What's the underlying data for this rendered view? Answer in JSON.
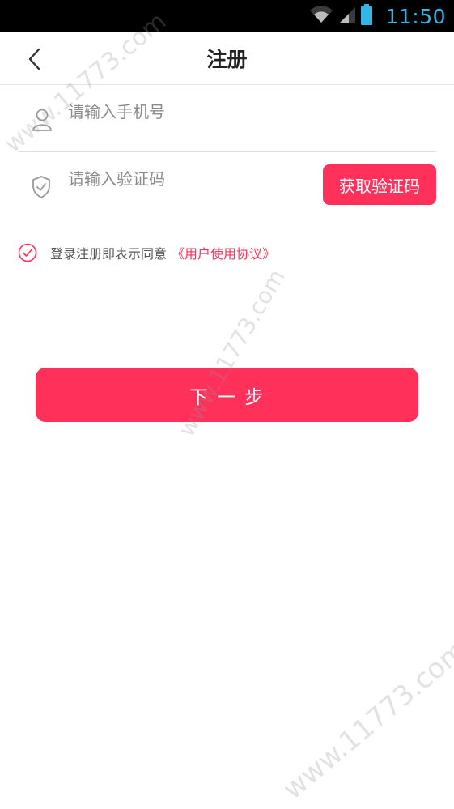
{
  "status_bar": {
    "time": "11:50",
    "icons": [
      "wifi-icon",
      "signal-icon",
      "battery-icon"
    ]
  },
  "header": {
    "title": "注册",
    "back_icon": "chevron-left-icon"
  },
  "form": {
    "phone": {
      "placeholder": "请输入手机号",
      "value": "",
      "icon": "user-icon"
    },
    "code": {
      "placeholder": "请输入验证码",
      "value": "",
      "icon": "shield-icon",
      "button_label": "获取验证码"
    }
  },
  "agreement": {
    "checked": true,
    "text": "登录注册即表示同意",
    "link_text": "《用户使用协议》"
  },
  "next_button_label": "下 一 步",
  "watermark": {
    "text": "www.11773.com"
  },
  "colors": {
    "accent": "#ff3059",
    "status_bar_bg": "#000000",
    "status_text": "#33b5e5"
  }
}
